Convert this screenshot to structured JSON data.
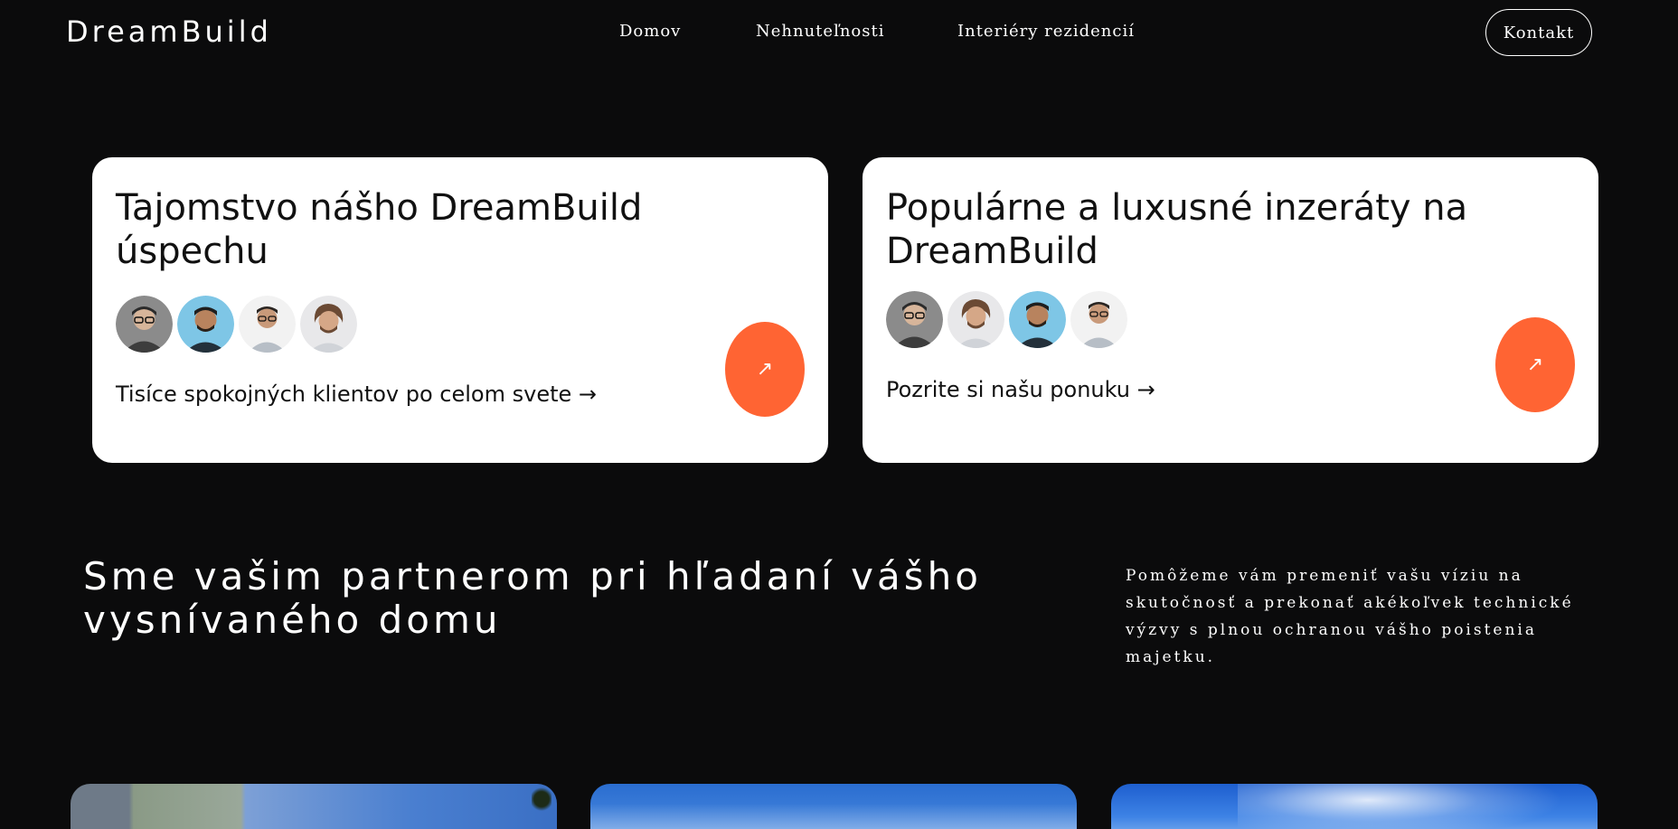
{
  "header": {
    "logo": "DreamBuild",
    "nav": [
      "Domov",
      "Nehnuteľnosti",
      "Interiéry rezidencií"
    ],
    "contact_label": "Kontakt"
  },
  "cards": [
    {
      "title": "Tajomstvo nášho DreamBuild úspechu",
      "link": "Tisíce spokojných klientov po celom svete →",
      "arrow": "↗"
    },
    {
      "title": "Populárne a luxusné inzeráty na DreamBuild",
      "link": "Pozrite si našu ponuku →",
      "arrow": "↗"
    }
  ],
  "partner": {
    "heading": "Sme vašim partnerom pri hľadaní vášho vysnívaného domu",
    "text": "Pomôžeme vám premeniť vašu víziu na skutočnosť a prekonať akékoľvek technické výzvy s plnou ochranou vášho poistenia majetku."
  },
  "colors": {
    "background": "#0b0b0c",
    "card": "#ffffff",
    "accent": "#ff6433"
  }
}
